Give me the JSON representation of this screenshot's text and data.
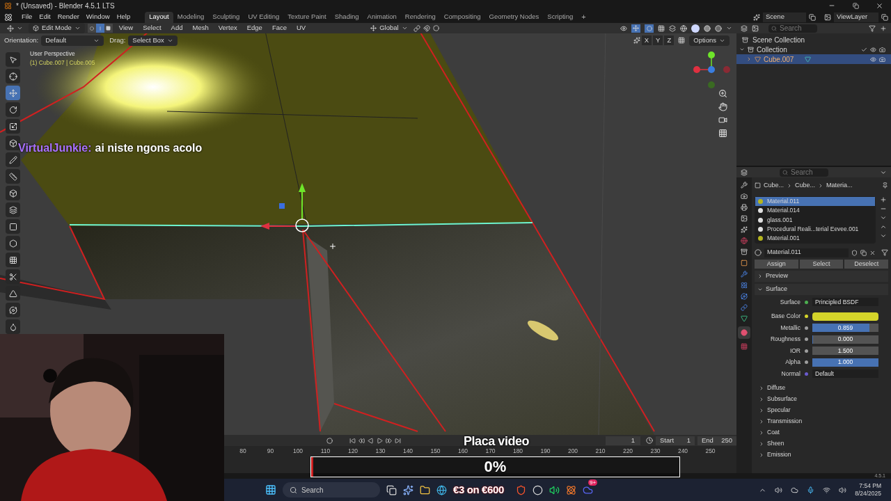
{
  "window": {
    "title": "* (Unsaved) - Blender 4.5.1 LTS"
  },
  "menu": [
    "File",
    "Edit",
    "Render",
    "Window",
    "Help"
  ],
  "workspaces": [
    {
      "label": "Layout",
      "selected": true
    },
    {
      "label": "Modeling",
      "selected": false
    },
    {
      "label": "Sculpting",
      "selected": false
    },
    {
      "label": "UV Editing",
      "selected": false
    },
    {
      "label": "Texture Paint",
      "selected": false
    },
    {
      "label": "Shading",
      "selected": false
    },
    {
      "label": "Animation",
      "selected": false
    },
    {
      "label": "Rendering",
      "selected": false
    },
    {
      "label": "Compositing",
      "selected": false
    },
    {
      "label": "Geometry Nodes",
      "selected": false
    },
    {
      "label": "Scripting",
      "selected": false
    }
  ],
  "add_workspace": "+",
  "scene": "Scene",
  "view_layer": "ViewLayer",
  "viewport": {
    "mode": "Edit Mode",
    "select_modes": [
      {
        "kind": "vertex",
        "selected": false
      },
      {
        "kind": "edge",
        "selected": true
      },
      {
        "kind": "face",
        "selected": false
      }
    ],
    "menus": [
      "View",
      "Select",
      "Add",
      "Mesh",
      "Vertex",
      "Edge",
      "Face",
      "UV"
    ],
    "transform_orientation": "Global",
    "orientation_label": "Orientation:",
    "orientation": "Default",
    "drag_label": "Drag:",
    "drag": "Select Box",
    "axes": [
      "X",
      "Y",
      "Z"
    ],
    "options": "Options",
    "perspective": "User Perspective",
    "object_info": "(1) Cube.007 | Cube.005",
    "tools": [
      {
        "kind": "select",
        "selected": false
      },
      {
        "kind": "cursor",
        "selected": false
      },
      {
        "kind": "move",
        "selected": true
      },
      {
        "kind": "rotate",
        "selected": false
      },
      {
        "kind": "scale",
        "selected": false
      },
      {
        "kind": "transform",
        "selected": false
      },
      {
        "kind": "annotate",
        "selected": false
      },
      {
        "kind": "measure",
        "selected": false
      },
      {
        "kind": "add-cube",
        "selected": false
      },
      {
        "kind": "extrude",
        "selected": false
      },
      {
        "kind": "inset",
        "selected": false
      },
      {
        "kind": "bevel",
        "selected": false
      },
      {
        "kind": "loop-cut",
        "selected": false
      },
      {
        "kind": "knife",
        "selected": false
      },
      {
        "kind": "poly-build",
        "selected": false
      },
      {
        "kind": "spin",
        "selected": false
      },
      {
        "kind": "smooth",
        "selected": false
      }
    ]
  },
  "chat": {
    "user": "VirtualJunkie:",
    "message": "ai niste ngons acolo"
  },
  "outliner": {
    "search_placeholder": "Search",
    "root": "Scene Collection",
    "tree": [
      {
        "label": "Collection",
        "expanded": true,
        "selected": false,
        "children": [
          {
            "label": "Cube.007",
            "expanded": false,
            "selected": true
          }
        ]
      }
    ]
  },
  "properties": {
    "search_placeholder": "Search",
    "breadcrumb": [
      "Cube...",
      "Cube...",
      "Materia..."
    ],
    "materials": [
      {
        "name": "Material.011",
        "selected": true,
        "color": "#b5b51e"
      },
      {
        "name": "Material.014",
        "selected": false,
        "color": "#e0e0e0"
      },
      {
        "name": "glass.001",
        "selected": false,
        "color": "#e0e0e0"
      },
      {
        "name": "Procedural Reali...terial Eevee.001",
        "selected": false,
        "color": "#e0e0e0"
      },
      {
        "name": "Material.001",
        "selected": false,
        "color": "#b5b51e"
      }
    ],
    "material_name": "Material.011",
    "buttons": [
      "Assign",
      "Select",
      "Deselect"
    ],
    "panels": [
      {
        "label": "Preview",
        "expanded": false
      },
      {
        "label": "Surface",
        "expanded": true
      }
    ],
    "fields": [
      {
        "label": "Surface",
        "kind": "link",
        "value": "Principled BSDF",
        "color": "#4caf50"
      },
      {
        "label": "Base Color",
        "kind": "color",
        "color": "#d4d42a"
      },
      {
        "label": "Metallic",
        "kind": "slider",
        "value": "0.859",
        "level": 0.859,
        "color": "#9e9e9e"
      },
      {
        "label": "Roughness",
        "kind": "slider",
        "value": "0.000",
        "level": 0,
        "color": "#9e9e9e"
      },
      {
        "label": "IOR",
        "kind": "number",
        "value": "1.500",
        "color": "#9e9e9e"
      },
      {
        "label": "Alpha",
        "kind": "slider",
        "value": "1.000",
        "level": 1,
        "color": "#9e9e9e"
      },
      {
        "label": "Normal",
        "kind": "link",
        "value": "Default",
        "color": "#6a5acd"
      }
    ],
    "subpanels": [
      "Diffuse",
      "Subsurface",
      "Specular",
      "Transmission",
      "Coat",
      "Sheen",
      "Emission"
    ]
  },
  "timeline": {
    "frame": "1",
    "start_label": "Start",
    "start": "1",
    "end_label": "End",
    "end": "250",
    "ticks": [
      "80",
      "90",
      "100",
      "110",
      "120",
      "130",
      "140",
      "150",
      "160",
      "170",
      "180",
      "190",
      "200",
      "210",
      "220",
      "230",
      "240",
      "250"
    ]
  },
  "stream": {
    "title": "Placa video",
    "progress": "0%",
    "level": 0
  },
  "status": {
    "version": "4.5.1"
  },
  "taskbar": {
    "search_placeholder": "Search",
    "promo": "€3 on €600",
    "badge": "9+",
    "time": "7:54 PM",
    "date": "8/24/2025"
  }
}
